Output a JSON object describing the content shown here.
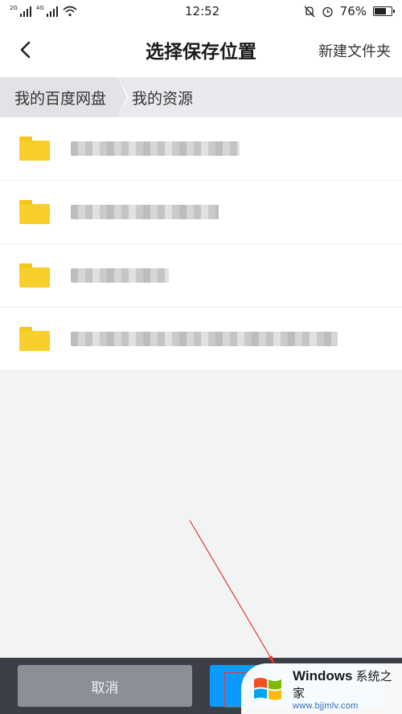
{
  "status_bar": {
    "network_top": "2G",
    "network_bottom": "4G",
    "time": "12:52",
    "battery_text": "76%",
    "battery_level": 0.76,
    "icons": [
      "signal-icon",
      "wifi-icon",
      "bell-off-icon",
      "alarm-icon",
      "battery-icon"
    ]
  },
  "header": {
    "title": "选择保存位置",
    "back_icon": "chevron-left-icon",
    "new_folder_label": "新建文件夹"
  },
  "breadcrumb": {
    "items": [
      "我的百度网盘",
      "我的资源"
    ]
  },
  "folders": [
    {
      "name": "▇▇▇ ▇▇▇▇▇ ▇▇▇ ▇▇",
      "icon": "folder-icon"
    },
    {
      "name": "▇▇▇▇▇▇▇▇▇▇▇▇▇▇▇",
      "icon": "folder-icon"
    },
    {
      "name": "▇▇▇▇▇▇ ▇▇",
      "icon": "folder-icon"
    },
    {
      "name": "▇▇▇▇▇▇▇▇▇▇▇ ▇▇▇▇▇▇▇▇",
      "icon": "folder-icon"
    }
  ],
  "bottom_bar": {
    "cancel_label": "取消",
    "confirm_label": ""
  },
  "watermark": {
    "brand": "Windows",
    "brand_cn": "系统之家",
    "url": "www.bjjmlv.com"
  },
  "colors": {
    "accent": "#0b9bff",
    "folder": "#f7cf2b",
    "annotation": "#e53935",
    "bottom_bar": "#3b3f47"
  }
}
